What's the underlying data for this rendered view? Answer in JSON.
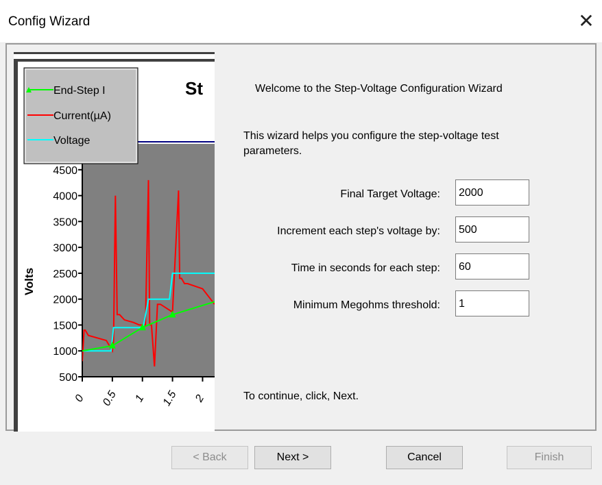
{
  "window": {
    "title": "Config Wizard",
    "close_glyph": "✕"
  },
  "chart": {
    "title_partial": "St",
    "ylabel": "Volts",
    "legend": [
      "End-Step I",
      "Current(µA)",
      "Voltage"
    ],
    "y_ticks": [
      "3000",
      "4500",
      "4000",
      "3500",
      "3000",
      "2500",
      "2000",
      "1500",
      "1000",
      "500"
    ],
    "x_ticks": [
      "0",
      "0.5",
      "1",
      "1.5",
      "2"
    ]
  },
  "chart_data": {
    "type": "line",
    "title": "St",
    "xlabel": "",
    "ylabel": "Volts",
    "ylim": [
      500,
      5000
    ],
    "xlim": [
      0,
      2.2
    ],
    "series": [
      {
        "name": "Current(µA)",
        "color": "#ff0000",
        "x": [
          0,
          0.03,
          0.05,
          0.1,
          0.4,
          0.5,
          0.52,
          0.55,
          0.58,
          0.62,
          0.7,
          0.85,
          0.95,
          1.05,
          1.1,
          1.12,
          1.15,
          1.2,
          1.25,
          1.3,
          1.5,
          1.6,
          1.62,
          1.65,
          1.7,
          1.75,
          2.0,
          2.2
        ],
        "y": [
          800,
          1400,
          1400,
          1300,
          1200,
          1000,
          1200,
          4000,
          1700,
          1700,
          1600,
          1550,
          1500,
          1500,
          4300,
          1500,
          1500,
          700,
          1900,
          1900,
          1750,
          4100,
          2400,
          2400,
          2300,
          2300,
          2200,
          1900
        ]
      },
      {
        "name": "Voltage",
        "color": "#00ffff",
        "x": [
          0,
          0.48,
          0.52,
          1.0,
          1.02,
          1.1,
          1.45,
          1.5,
          2.2
        ],
        "y": [
          1000,
          1000,
          1450,
          1450,
          1500,
          2000,
          2000,
          2500,
          2500
        ]
      },
      {
        "name": "End-Step I",
        "color": "#00ff00",
        "x": [
          0,
          0.5,
          1.0,
          1.5,
          2.2
        ],
        "y": [
          1000,
          1100,
          1450,
          1700,
          1950
        ]
      }
    ],
    "legend": "top-left",
    "grid": false
  },
  "content": {
    "welcome": "Welcome to the Step-Voltage Configuration Wizard",
    "description_line1": "This wizard helps you configure the step-voltage test",
    "description_line2": "parameters.",
    "fields": [
      {
        "label": "Final Target Voltage:",
        "value": "2000"
      },
      {
        "label": "Increment each step's voltage by:",
        "value": "500"
      },
      {
        "label": "Time in seconds for each step:",
        "value": "60"
      },
      {
        "label": "Minimum Megohms threshold:",
        "value": "1"
      }
    ],
    "continue_text": "To continue, click, Next."
  },
  "buttons": {
    "back": "< Back",
    "next": "Next >",
    "cancel": "Cancel",
    "finish": "Finish"
  }
}
